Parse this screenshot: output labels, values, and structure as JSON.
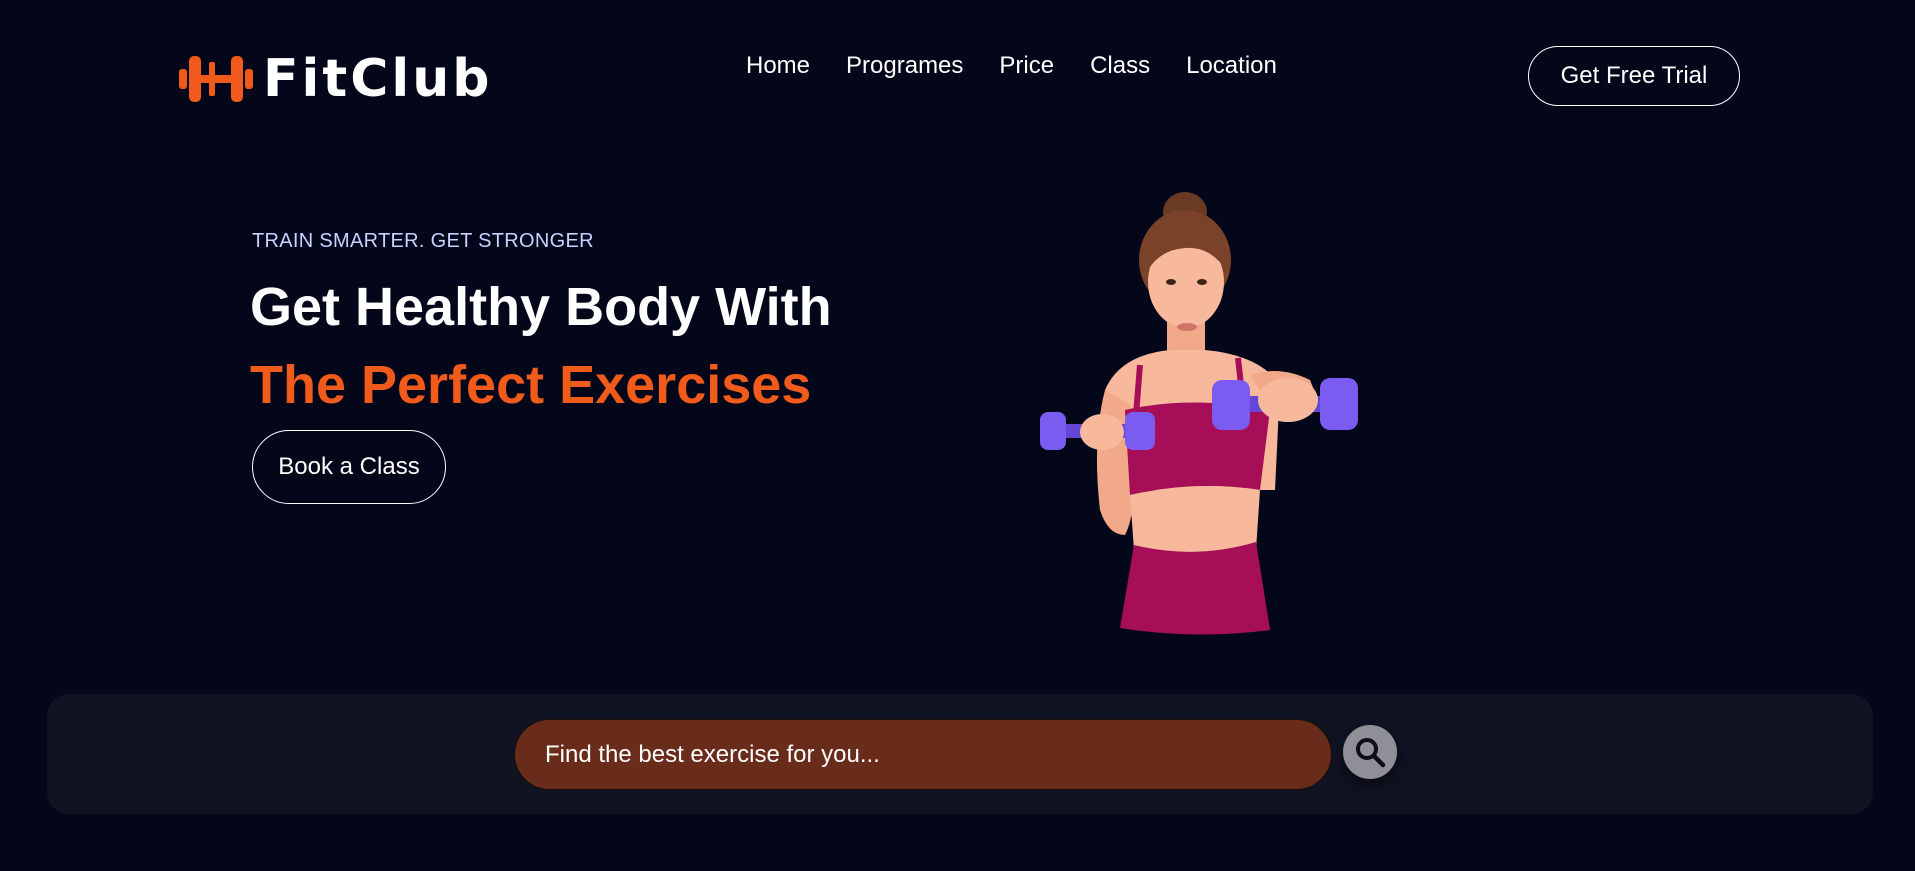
{
  "brand": {
    "name": "FitClub",
    "accent_color": "#f05a1a",
    "logo_icon": "dumbbell-icon"
  },
  "nav": {
    "items": [
      "Home",
      "Programes",
      "Price",
      "Class",
      "Location"
    ]
  },
  "header": {
    "trial_label": "Get Free Trial"
  },
  "hero": {
    "tagline": "TRAIN SMARTER. GET STRONGER",
    "headline_line1": "Get Healthy Body With",
    "headline_line2": "The Perfect Exercises",
    "cta_label": "Book a Class",
    "image_icon": "woman-with-dumbbells-illustration"
  },
  "search": {
    "placeholder": "Find the best exercise for you...",
    "button_icon": "search-icon"
  }
}
